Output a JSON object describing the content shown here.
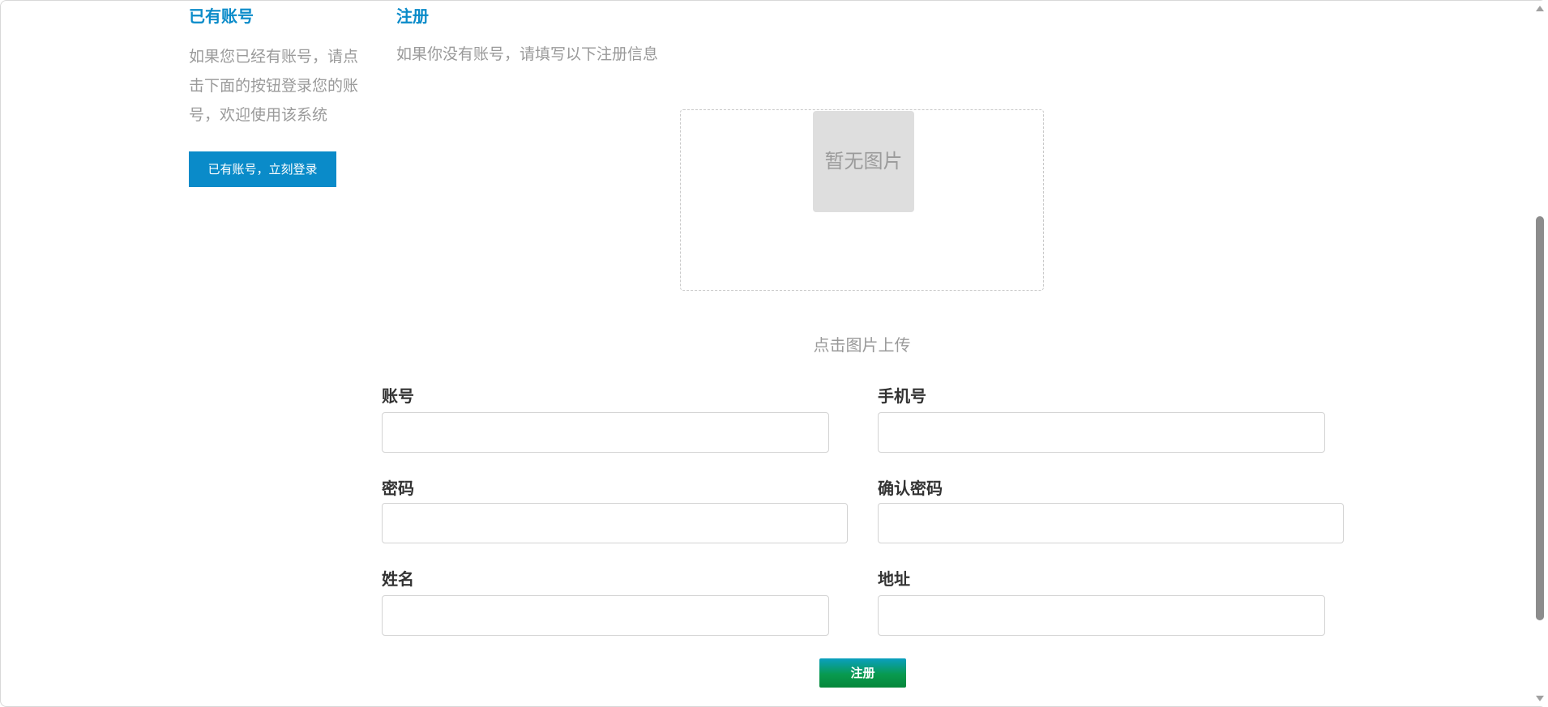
{
  "login": {
    "title": "已有账号",
    "description": "如果您已经有账号，请点击下面的按钮登录您的账号，欢迎使用该系统",
    "button_label": "已有账号，立刻登录"
  },
  "register": {
    "title": "注册",
    "description": "如果你没有账号，请填写以下注册信息",
    "upload": {
      "placeholder": "暂无图片",
      "hint": "点击图片上传"
    },
    "fields": {
      "account": {
        "label": "账号",
        "value": ""
      },
      "phone": {
        "label": "手机号",
        "value": ""
      },
      "password": {
        "label": "密码",
        "value": ""
      },
      "confirm_password": {
        "label": "确认密码",
        "value": ""
      },
      "name": {
        "label": "姓名",
        "value": ""
      },
      "address": {
        "label": "地址",
        "value": ""
      }
    },
    "submit_label": "注册"
  },
  "colors": {
    "accent": "#0a8bc9",
    "submit_green": "#089a4f",
    "muted_text": "#9a9a9a"
  }
}
